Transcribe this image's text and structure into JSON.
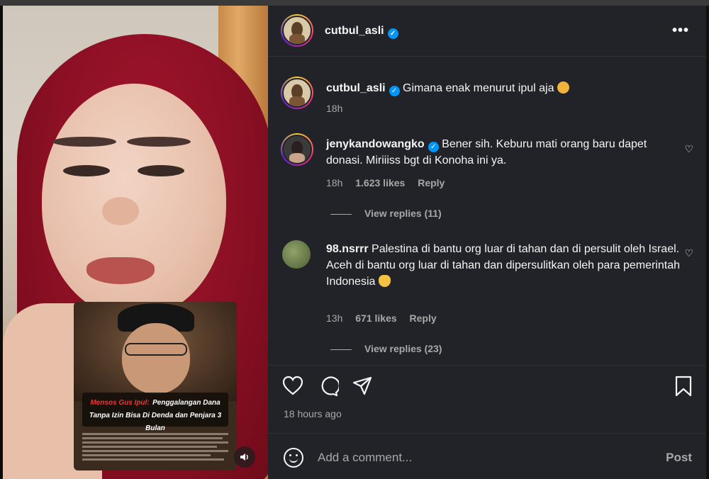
{
  "post": {
    "author": "cutbul_asli",
    "more_icon": "more-horizontal-icon",
    "caption": {
      "username": "cutbul_asli",
      "text": "Gimana enak menurut ipul aja",
      "time": "18h"
    }
  },
  "media": {
    "card": {
      "headline_red": "Mensos Gus Ipul:",
      "headline_white": "Penggalangan Dana Tanpa Izin Bisa Di Denda dan Penjara 3 Bulan"
    },
    "mute_icon": "speaker-icon"
  },
  "comments": [
    {
      "username": "jenykandowangko",
      "verified": true,
      "text": "Bener sih. Keburu mati orang baru dapet donasi. Miriiiss bgt di Konoha ini ya.",
      "time": "18h",
      "likes": "1.623 likes",
      "reply": "Reply",
      "view_replies": "View replies (11)"
    },
    {
      "username": "98.nsrrr",
      "verified": false,
      "text_line1": "Palestina di bantu org luar di tahan dan di persulit oleh Israel.",
      "text_line2": "Aceh di bantu org luar di tahan dan dipersulitkan oleh para pemerintah Indonesia",
      "time": "13h",
      "likes": "671 likes",
      "reply": "Reply",
      "view_replies": "View replies (23)"
    }
  ],
  "actions": {
    "time_ago": "18 hours ago"
  },
  "add_comment": {
    "placeholder": "Add a comment...",
    "post_label": "Post"
  },
  "colors": {
    "panel_bg": "#212328",
    "verified": "#0095f6",
    "muted_text": "#a8a8a8"
  }
}
